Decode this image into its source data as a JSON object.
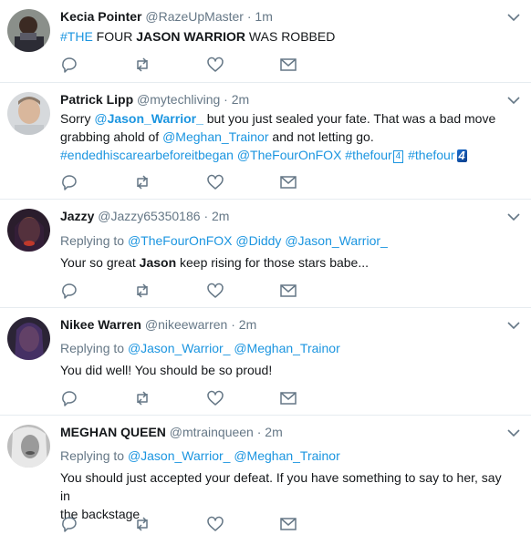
{
  "tweets": [
    {
      "name": "Kecia Pointer",
      "handle": "@RazeUpMaster",
      "time": "1m",
      "text_parts": [
        {
          "t": "#THE",
          "style": "link"
        },
        {
          "t": " FOUR ",
          "style": "plain"
        },
        {
          "t": "JASON WARRIOR",
          "style": "bold"
        },
        {
          "t": " WAS ROBBED",
          "style": "plain"
        }
      ]
    },
    {
      "name": "Patrick Lipp",
      "handle": "@mytechliving",
      "time": "2m",
      "line1": [
        "Sorry ",
        "@",
        "Jason_Warrior_",
        " but you just sealed your fate. That was a bad move"
      ],
      "line2": [
        "grabbing ahold of ",
        "@Meghan_Trainor",
        " and not letting go."
      ],
      "line3": [
        "#endedhiscarearbeforeitbegan",
        " ",
        "@TheFourOnFOX",
        " ",
        "#thefour",
        "4",
        " ",
        "#thefour",
        "4"
      ]
    },
    {
      "name": "Jazzy",
      "handle": "@Jazzy65350186",
      "time": "2m",
      "replying_label": "Replying to",
      "replying_to": [
        "@TheFourOnFOX",
        "@Diddy",
        "@Jason_Warrior_"
      ],
      "text": [
        "Your so great ",
        "Jason",
        " keep rising for those stars babe..."
      ]
    },
    {
      "name": "Nikee Warren",
      "handle": "@nikeewarren",
      "time": "2m",
      "replying_label": "Replying to",
      "replying_to": [
        "@Jason_Warrior_",
        "@Meghan_Trainor"
      ],
      "text": "You did well! You should be so proud!"
    },
    {
      "name": "MEGHAN QUEEN",
      "handle": "@mtrainqueen",
      "time": "2m",
      "replying_label": "Replying to",
      "replying_to": [
        "@Jason_Warrior_",
        "@Meghan_Trainor"
      ],
      "text_line1": "You should just accepted your defeat. If you have something to say to her, say in",
      "text_line2": "the backstage"
    }
  ],
  "separator": "·",
  "colors": {
    "link": "#1b95e0",
    "muted": "#657786",
    "text": "#14171a",
    "border": "#e6ecf0"
  }
}
